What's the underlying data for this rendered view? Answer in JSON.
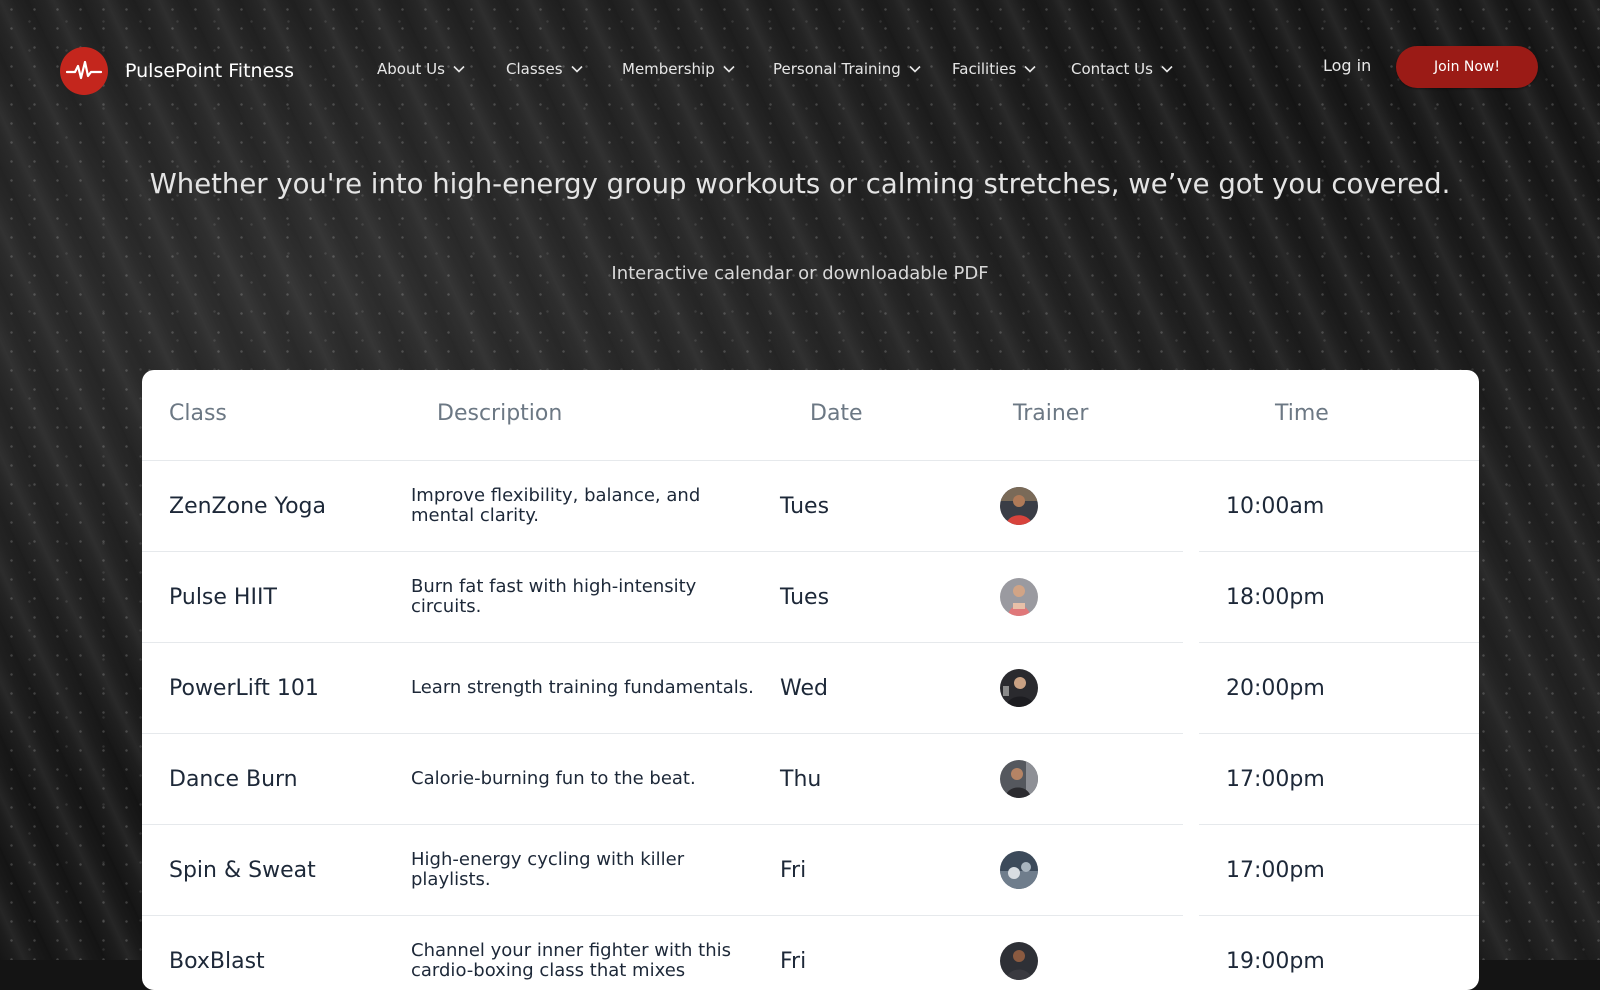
{
  "brand": {
    "name": "PulsePoint Fitness",
    "accent": "#c4261d"
  },
  "nav": {
    "items": [
      {
        "label": "About Us"
      },
      {
        "label": "Classes"
      },
      {
        "label": "Membership"
      },
      {
        "label": "Personal Training"
      },
      {
        "label": "Facilities"
      },
      {
        "label": "Contact Us"
      }
    ],
    "login_label": "Log in",
    "join_label": "Join Now!"
  },
  "hero": {
    "tagline": "Whether you're into high-energy group workouts or calming stretches, we’ve got you covered.",
    "subline": "Interactive calendar or downloadable PDF"
  },
  "schedule": {
    "columns": [
      "Class",
      "Description",
      "Date",
      "Trainer",
      "Time"
    ],
    "rows": [
      {
        "class": "ZenZone Yoga",
        "description": "Improve flexibility, balance, and mental clarity.",
        "date": "Tues",
        "trainer_avatar": "avatar-icon",
        "time": "10:00am"
      },
      {
        "class": "Pulse HIIT",
        "description": "Burn fat fast with high-intensity circuits.",
        "date": "Tues",
        "trainer_avatar": "avatar-icon",
        "time": "18:00pm"
      },
      {
        "class": "PowerLift 101",
        "description": "Learn strength training fundamentals.",
        "date": "Wed",
        "trainer_avatar": "avatar-icon",
        "time": "20:00pm"
      },
      {
        "class": "Dance Burn",
        "description": "Calorie-burning fun to the beat.",
        "date": "Thu",
        "trainer_avatar": "avatar-icon",
        "time": "17:00pm"
      },
      {
        "class": "Spin & Sweat",
        "description": "High-energy cycling with killer playlists.",
        "date": "Fri",
        "trainer_avatar": "avatar-icon",
        "time": "17:00pm"
      },
      {
        "class": "BoxBlast",
        "description": "Channel your inner fighter with this cardio-boxing class that mixes",
        "date": "Fri",
        "trainer_avatar": "avatar-icon",
        "time": "19:00pm"
      }
    ]
  }
}
